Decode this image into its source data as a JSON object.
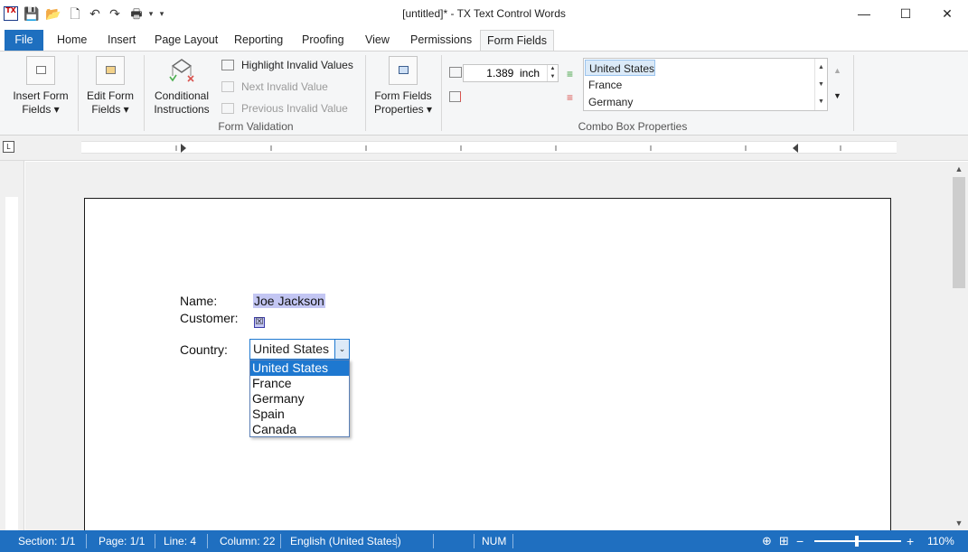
{
  "window": {
    "title": "[untitled]* - TX Text Control Words",
    "app_icon_text": "TX",
    "minimize": "—",
    "maximize": "☐",
    "close": "✕"
  },
  "quick_access": {
    "save": "💾",
    "open": "📂",
    "new": "🗋",
    "undo": "↶",
    "redo": "↷",
    "print": "🖶",
    "more": "▾"
  },
  "tabs": {
    "file": "File",
    "home": "Home",
    "insert": "Insert",
    "page_layout": "Page Layout",
    "reporting": "Reporting",
    "proofing": "Proofing",
    "view": "View",
    "permissions": "Permissions",
    "form_fields": "Form Fields"
  },
  "ribbon": {
    "insert_form_fields": "Insert Form Fields ▾",
    "insert_form_fields_l1": "Insert Form",
    "insert_form_fields_l2": "Fields ▾",
    "edit_form_fields_l1": "Edit Form",
    "edit_form_fields_l2": "Fields ▾",
    "conditional_l1": "Conditional",
    "conditional_l2": "Instructions",
    "highlight_invalid": "Highlight Invalid Values",
    "next_invalid": "Next Invalid Value",
    "previous_invalid": "Previous Invalid Value",
    "form_validation_label": "Form Validation",
    "form_fields_props_l1": "Form Fields",
    "form_fields_props_l2": "Properties ▾",
    "width_value": "1.389  inch",
    "combo_items": [
      "United States",
      "France",
      "Germany"
    ],
    "combo_box_properties_label": "Combo Box Properties",
    "scroll_up": "▲",
    "scroll_down": "▼"
  },
  "document": {
    "name_label": "Name:",
    "name_value": "Joe Jackson",
    "customer_label": "Customer:",
    "customer_check": "☒",
    "country_label": "Country:",
    "country_value": "United States",
    "combo_arrow": "⌄",
    "country_options": [
      "United States",
      "France",
      "Germany",
      "Spain",
      "Canada"
    ]
  },
  "status": {
    "section": "Section: 1/1",
    "page": "Page: 1/1",
    "line": "Line: 4",
    "column": "Column: 22",
    "language": "English (United States)",
    "num": "NUM",
    "zoom_minus": "−",
    "zoom_plus": "+",
    "zoom": "110%"
  }
}
